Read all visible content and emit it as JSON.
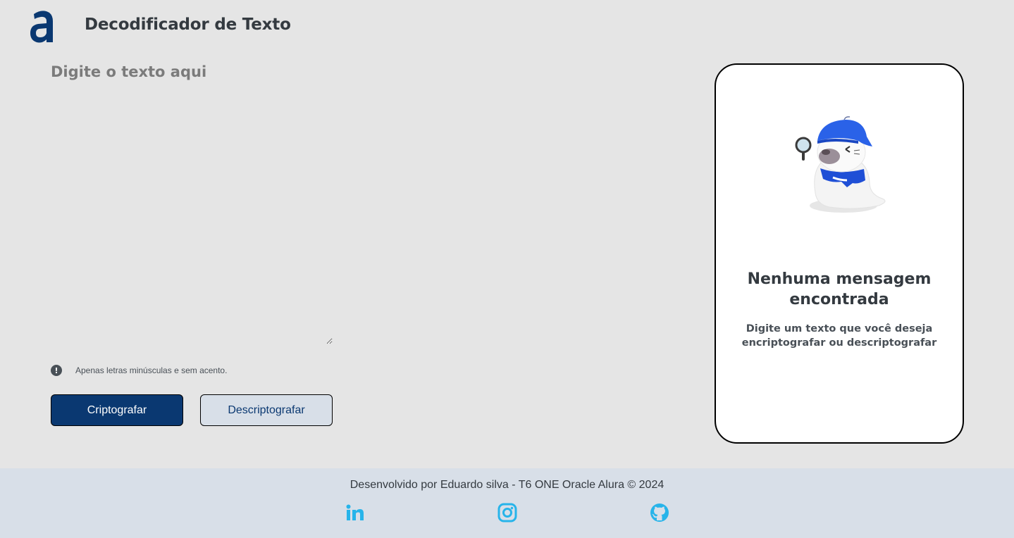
{
  "header": {
    "title": "Decodificador de Texto",
    "logo_icon": "alura-logo-icon"
  },
  "input": {
    "placeholder": "Digite o texto aqui",
    "value": ""
  },
  "hint": {
    "icon": "exclamation-circle-icon",
    "text": "Apenas letras minúsculas e sem acento."
  },
  "buttons": {
    "encrypt_label": "Criptografar",
    "decrypt_label": "Descriptografar"
  },
  "output": {
    "title": "Nenhuma mensagem encontrada",
    "subtitle": "Digite um texto que você deseja encriptografar ou descriptografar",
    "illustration": "detective-seal-illustration"
  },
  "footer": {
    "text": "Desenvolvido por Eduardo silva - T6 ONE Oracle Alura © 2024",
    "links": [
      {
        "icon": "linkedin-icon"
      },
      {
        "icon": "instagram-icon"
      },
      {
        "icon": "github-icon"
      }
    ]
  },
  "colors": {
    "background": "#e5e5e5",
    "primary": "#0a3871",
    "secondary_button": "#d8dfe8",
    "footer_bg": "#d8dfe8",
    "social_icon": "#27b4ea"
  }
}
